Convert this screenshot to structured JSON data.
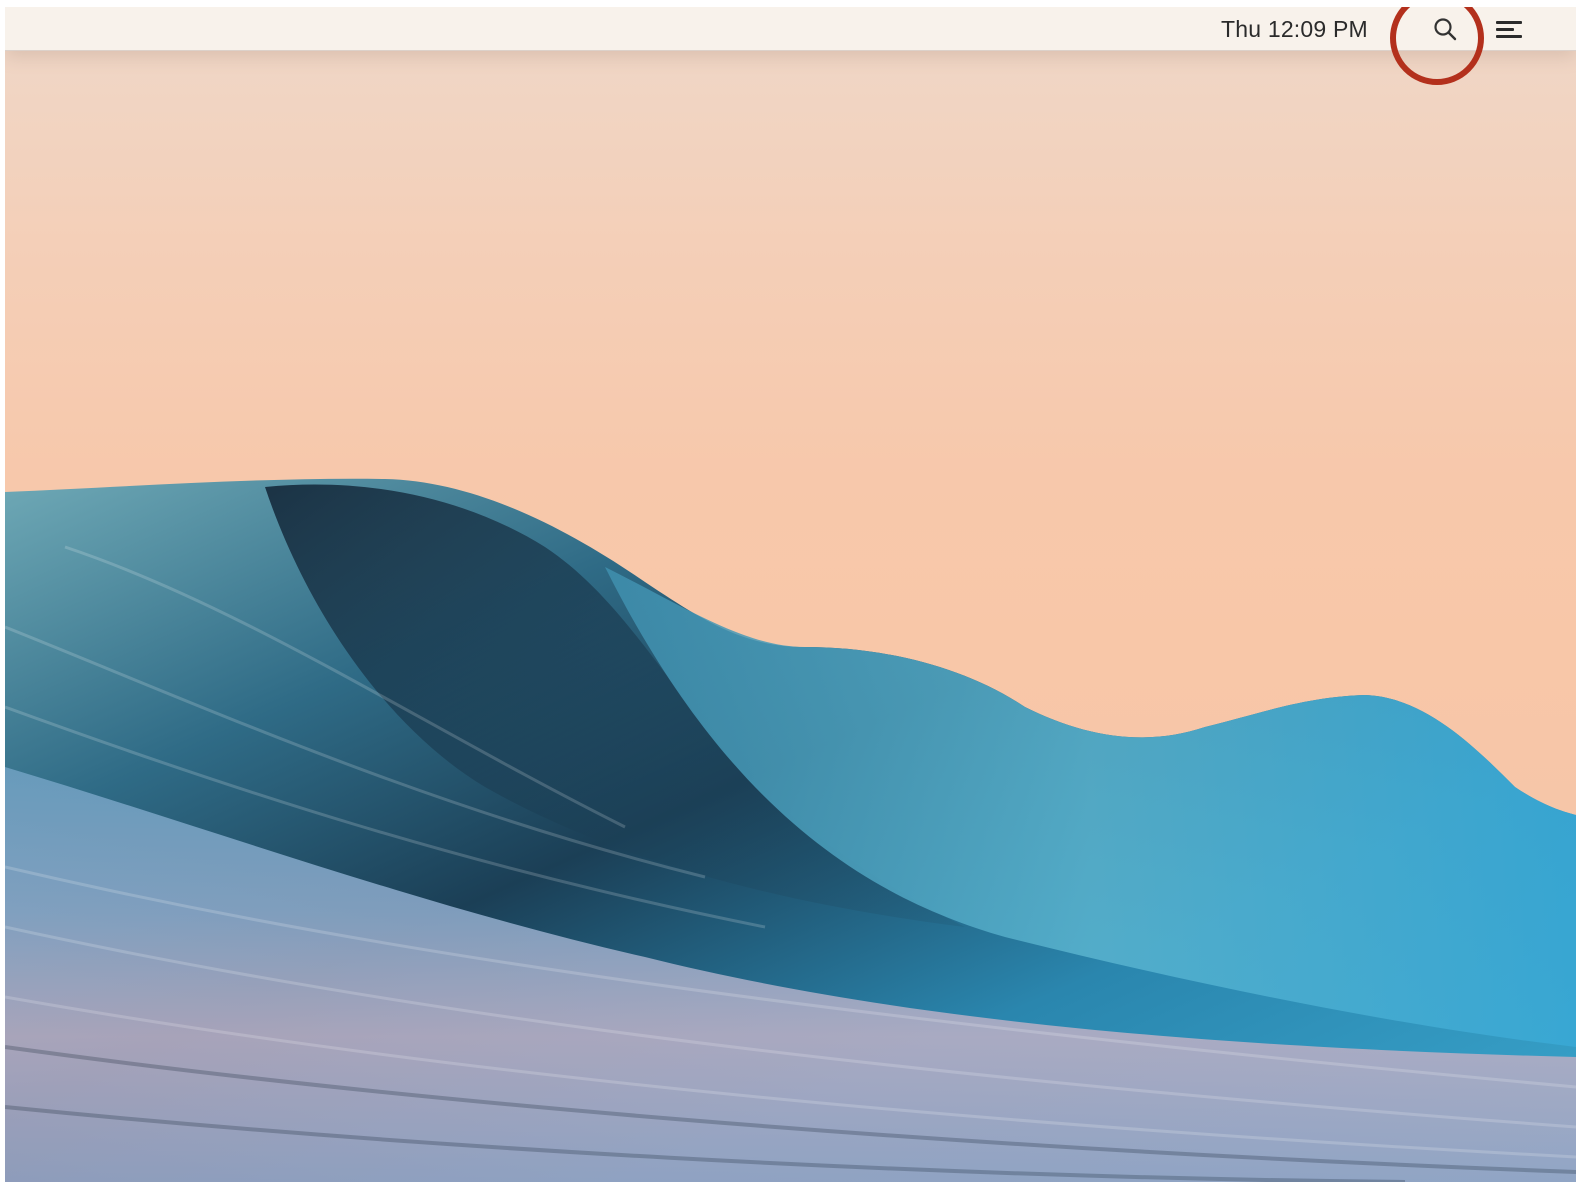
{
  "menubar": {
    "clock_text": "Thu 12:09 PM",
    "search_icon": "search-icon",
    "menu_icon": "notification-center-icon"
  },
  "annotation": {
    "highlight_color": "#b3301c",
    "highlight_target": "search-icon"
  },
  "wallpaper": {
    "subject": "ocean-wave",
    "sky_color": "#f6c8ab",
    "wave_color": "#2a8fb8"
  }
}
